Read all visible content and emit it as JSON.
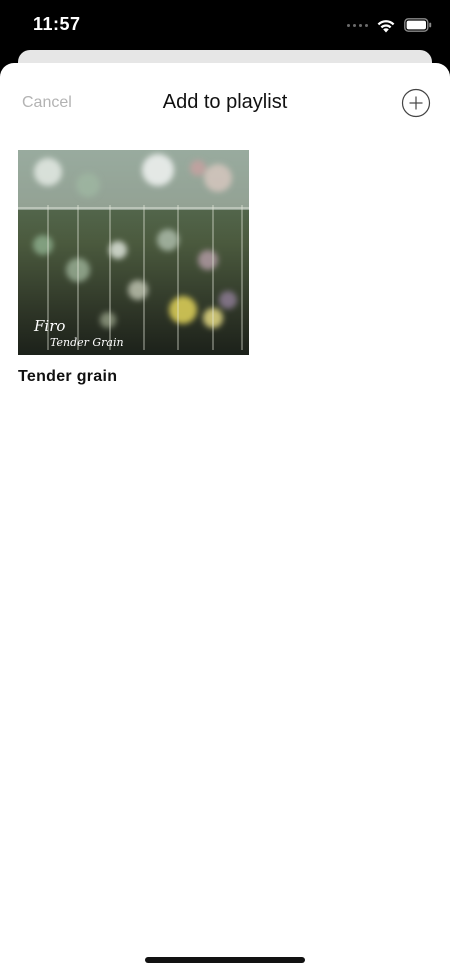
{
  "status_bar": {
    "time": "11:57",
    "icons": [
      "signal-dots-icon",
      "wifi-icon",
      "battery-icon"
    ]
  },
  "nav": {
    "cancel_label": "Cancel",
    "title": "Add to playlist",
    "add_icon": "plus-circle-icon"
  },
  "playlists": [
    {
      "name": "Tender grain",
      "cover_text_artist": "Firo",
      "cover_text_album": "Tender Grain"
    }
  ],
  "colors": {
    "cancel_text": "#b3b3b3",
    "sheet_background": "#ffffff",
    "status_bar_background": "#000000"
  }
}
